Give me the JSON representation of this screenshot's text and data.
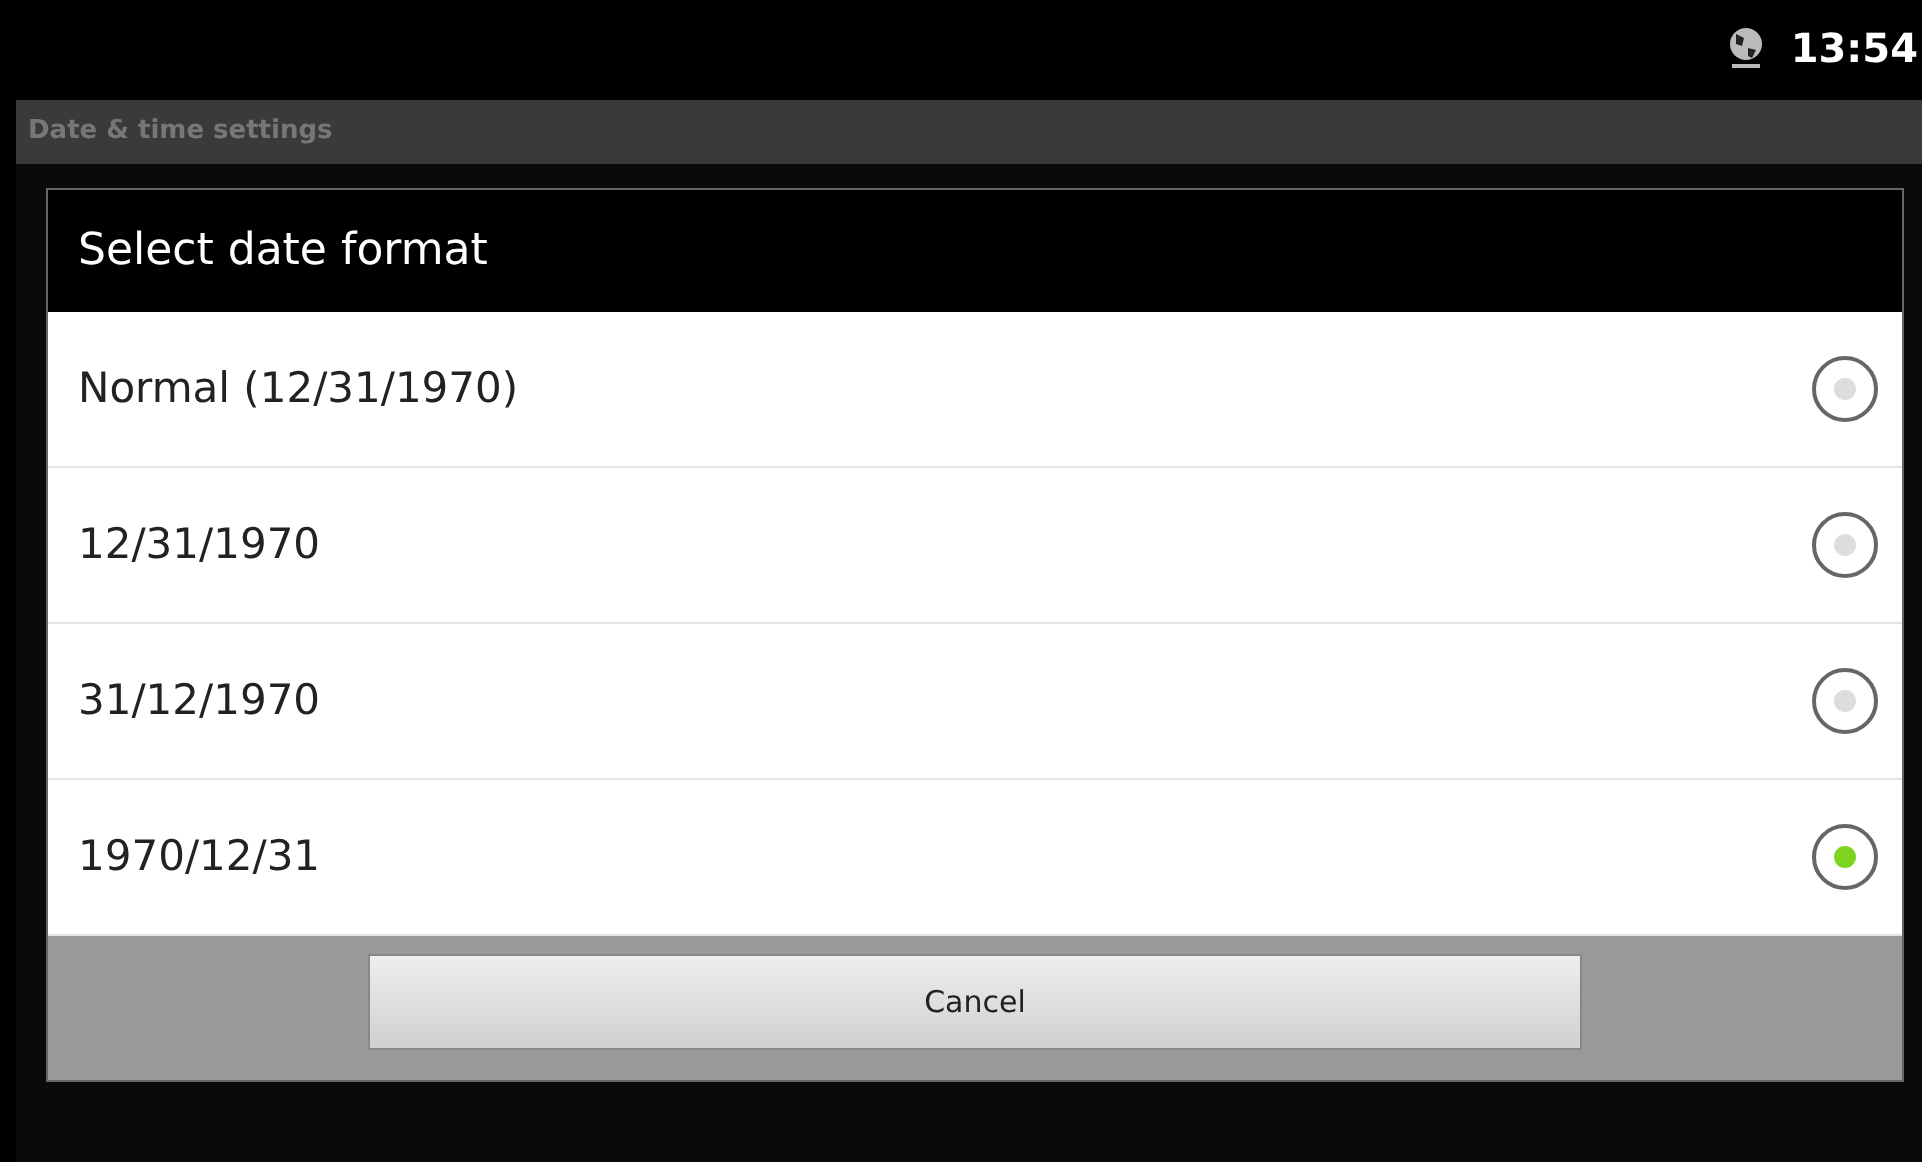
{
  "status_bar": {
    "time": "13:54"
  },
  "app_bar": {
    "title": "Date & time settings"
  },
  "dialog": {
    "title": "Select date format",
    "options": [
      {
        "label": "Normal (12/31/1970)",
        "selected": false
      },
      {
        "label": "12/31/1970",
        "selected": false
      },
      {
        "label": "31/12/1970",
        "selected": false
      },
      {
        "label": "1970/12/31",
        "selected": true
      }
    ],
    "buttons": [
      "Cancel"
    ]
  }
}
